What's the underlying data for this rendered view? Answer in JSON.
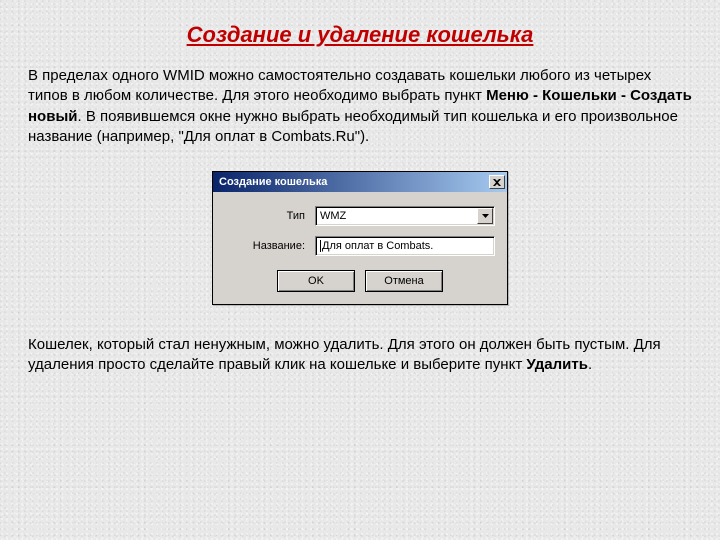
{
  "title": "Создание и удаление кошелька",
  "intro": {
    "part1": "В пределах одного WMID можно самостоятельно создавать кошельки любого из четырех типов в любом количестве. Для этого необходимо выбрать пункт ",
    "bold1": "Меню - Кошельки - Создать новый",
    "part2": ". В появившемся окне нужно выбрать необходимый тип кошелька и его произвольное название (например, \"Для оплат в Combats.Ru\")."
  },
  "dialog": {
    "title": "Создание кошелька",
    "type_label": "Тип",
    "type_value": "WMZ",
    "name_label": "Название:",
    "name_value": "Для оплат в Combats.",
    "ok": "OK",
    "cancel": "Отмена"
  },
  "outro": {
    "part1": "Кошелек, который стал ненужным, можно удалить. Для этого он должен быть пустым. Для удаления просто сделайте правый клик на кошельке и выберите пункт ",
    "bold1": "Удалить",
    "part2": "."
  }
}
